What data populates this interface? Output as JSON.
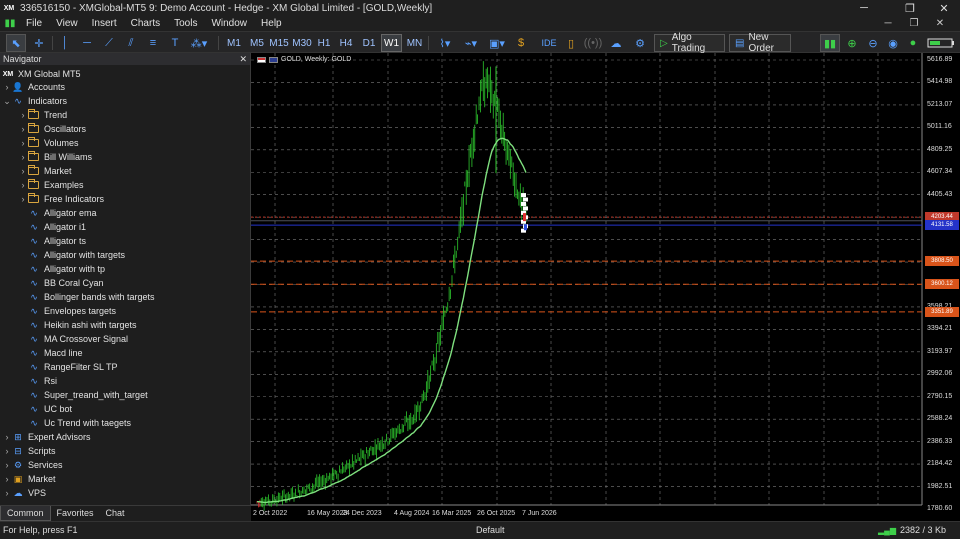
{
  "window": {
    "title": "336516150 - XMGlobal-MT5 9: Demo Account - Hedge - XM Global Limited - [GOLD,Weekly]",
    "logo": "XM"
  },
  "menu": [
    "File",
    "View",
    "Insert",
    "Charts",
    "Tools",
    "Window",
    "Help"
  ],
  "toolbar": {
    "timeframes": [
      "M1",
      "M5",
      "M15",
      "M30",
      "H1",
      "H4",
      "D1",
      "W1",
      "MN"
    ],
    "active_timeframe": "W1",
    "ide_label": "IDE",
    "algo_trading_label": "Algo Trading",
    "new_order_label": "New Order"
  },
  "navigator": {
    "title": "Navigator",
    "root": "XM Global MT5",
    "accounts": "Accounts",
    "indicators": "Indicators",
    "folders": [
      "Trend",
      "Oscillators",
      "Volumes",
      "Bill Williams",
      "Market",
      "Examples",
      "Free Indicators"
    ],
    "custom": [
      "Alligator ema",
      "Alligator i1",
      "Alligator ts",
      "Alligator with targets",
      "Alligator with tp",
      "BB Coral Cyan",
      "Bollinger bands with targets",
      "Envelopes targets",
      "Heikin ashi with targets",
      "MA Crossover Signal",
      "Macd line",
      "RangeFilter SL TP",
      "Rsi",
      "Super_treand_with_target",
      "UC bot",
      "Uc Trend with taegets"
    ],
    "bottom": [
      "Expert Advisors",
      "Scripts",
      "Services",
      "Market",
      "VPS"
    ],
    "tabs": [
      "Common",
      "Favorites",
      "Chat"
    ],
    "active_tab": "Common"
  },
  "chart": {
    "header": "GOLD, Weekly:  GOLD",
    "price_labels": [
      "5616.89",
      "5414.98",
      "5213.07",
      "5011.16",
      "4809.25",
      "4607.34",
      "4405.43",
      "3998.81",
      "3800.12",
      "3598.21",
      "3394.21",
      "3193.97",
      "2992.06",
      "2790.15",
      "2588.24",
      "2386.33",
      "2184.42",
      "1982.51",
      "1780.60"
    ],
    "tags": [
      {
        "label": "4203.44",
        "color": "#c0392b"
      },
      {
        "label": "4131.58",
        "color": "#2433c9"
      },
      {
        "label": "3808.50",
        "color": "#d9541a"
      },
      {
        "label": "3600.12",
        "color": "#d9541a"
      },
      {
        "label": "3351.89",
        "color": "#d9541a"
      }
    ],
    "time_labels": [
      "2 Oct 2022",
      "16 May 2023",
      "24 Dec 2023",
      "4 Aug 2024",
      "16 Mar 2025",
      "26 Oct 2025",
      "7 Jun 2026"
    ]
  },
  "status": {
    "help": "For Help, press F1",
    "profile": "Default",
    "traffic": "2382 / 3 Kb"
  },
  "colors": {
    "candle": "#2ec82e",
    "ma": "#7fe07f",
    "grid": "#7a7a7a"
  }
}
